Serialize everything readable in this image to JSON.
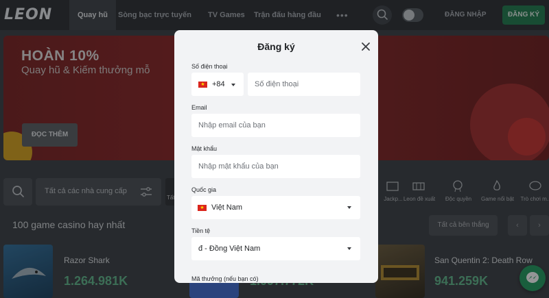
{
  "header": {
    "logo": "LEON",
    "nav": [
      "Quay hũ",
      "Sòng bạc trực tuyến",
      "TV Games",
      "Trận đấu hàng đầu"
    ],
    "more": "•••",
    "login": "ĐĂNG NHẬP",
    "register": "ĐĂNG KÝ"
  },
  "banner": {
    "title": "HOÀN 10%",
    "subtitle": "Quay hũ & Kiếm thưởng mỗ",
    "button": "ĐỌC THÊM"
  },
  "filters": {
    "provider": "Tất cả các nhà cung cấp",
    "first_category_fragment": "Tất",
    "categories": [
      "Jackp...",
      "Leon đề xuất",
      "Độc quyền",
      "Game nổi bật",
      "Trò chơi m..."
    ]
  },
  "section": {
    "title": "100 game casino hay nhất",
    "see_all": "Tất cả bên thắng",
    "prev": "‹",
    "next": "›"
  },
  "games": [
    {
      "name": "Razor Shark",
      "value": "1.264.981K"
    },
    {
      "name": "",
      "value": "1.097.772K"
    },
    {
      "name": "San Quentin 2: Death Row",
      "value": "941.259K"
    }
  ],
  "modal": {
    "title": "Đăng ký",
    "phone_label": "Số điện thoại",
    "phone_code": "+84",
    "phone_placeholder": "Số điện thoại",
    "email_label": "Email",
    "email_placeholder": "Nhập email của bạn",
    "password_label": "Mật khẩu",
    "password_placeholder": "Nhập mật khẩu của bạn",
    "country_label": "Quốc gia",
    "country_value": "Việt Nam",
    "currency_label": "Tiền tệ",
    "currency_value": "đ - Đồng Việt Nam",
    "promo_label": "Mã thưởng (nếu bạn có)"
  },
  "colors": {
    "primary_green": "#1e7b4b",
    "value_green": "#5fb98a",
    "banner_red": "#8e2323",
    "modal_bg": "#f2f3f5"
  },
  "icons": [
    "search-icon",
    "theme-toggle-icon",
    "close-icon",
    "filter-sliders-icon",
    "chevron-down-icon",
    "messenger-icon",
    "vietnam-flag-icon"
  ]
}
